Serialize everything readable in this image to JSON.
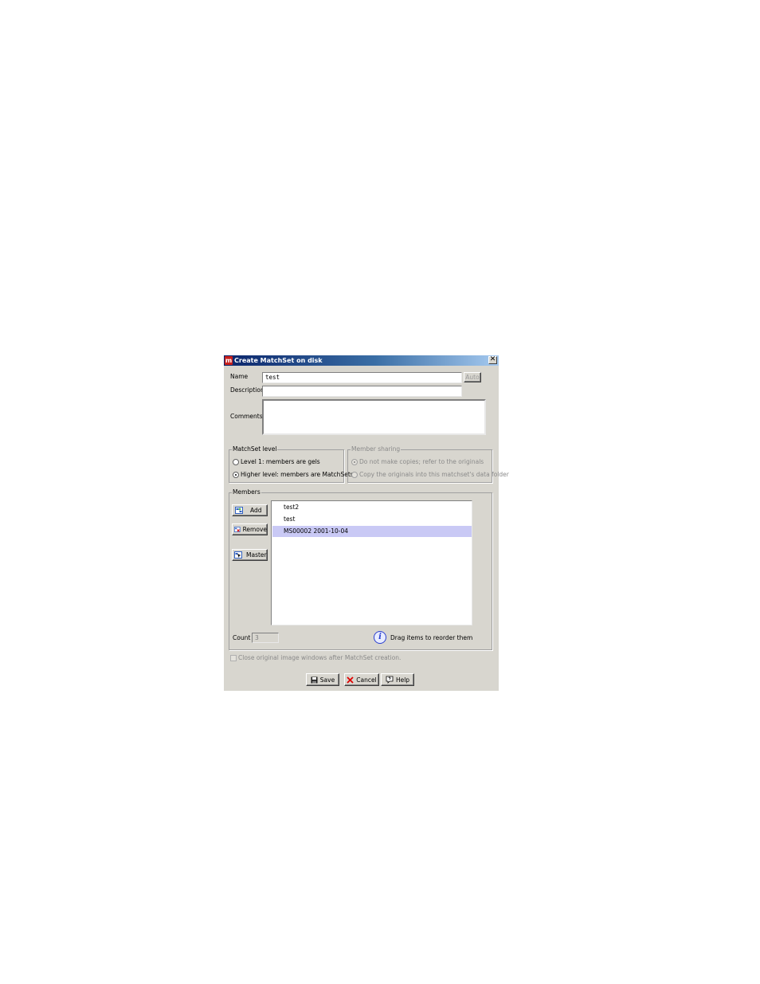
{
  "window": {
    "title": "Create MatchSet on disk",
    "close_glyph": "✕"
  },
  "form": {
    "name_label": "Name",
    "name_value": "test",
    "auto_button": "Auto",
    "description_label": "Description",
    "description_value": "",
    "comments_label": "Comments",
    "comments_value": ""
  },
  "matchset_level": {
    "title": "MatchSet level",
    "options": [
      {
        "label": "Level 1: members are gels",
        "checked": false
      },
      {
        "label": "Higher level: members are MatchSets",
        "checked": true
      }
    ]
  },
  "member_sharing": {
    "title": "Member sharing",
    "options": [
      {
        "label": "Do not make copies; refer to the originals",
        "checked": true
      },
      {
        "label": "Copy the originals into this matchset's data folder",
        "checked": false
      }
    ]
  },
  "members": {
    "title": "Members",
    "add_button": "Add",
    "remove_button": "Remove",
    "master_button": "Master",
    "items": [
      {
        "label": "test2",
        "selected": false
      },
      {
        "label": "test",
        "selected": false
      },
      {
        "label": "MS00002 2001-10-04",
        "selected": true
      }
    ],
    "count_label": "Count",
    "count_value": "3",
    "info_text": "Drag items to reorder them",
    "info_glyph": "i"
  },
  "close_windows_checkbox": {
    "label": "Close original image windows after MatchSet creation.",
    "checked": false
  },
  "buttons": {
    "save": "Save",
    "cancel": "Cancel",
    "help": "Help"
  },
  "colors": {
    "title_start": "#0a246a",
    "title_end": "#a6caf0",
    "dialog_bg": "#d8d6cf",
    "selection": "#c9c9f5",
    "cancel_x": "#e00000"
  }
}
